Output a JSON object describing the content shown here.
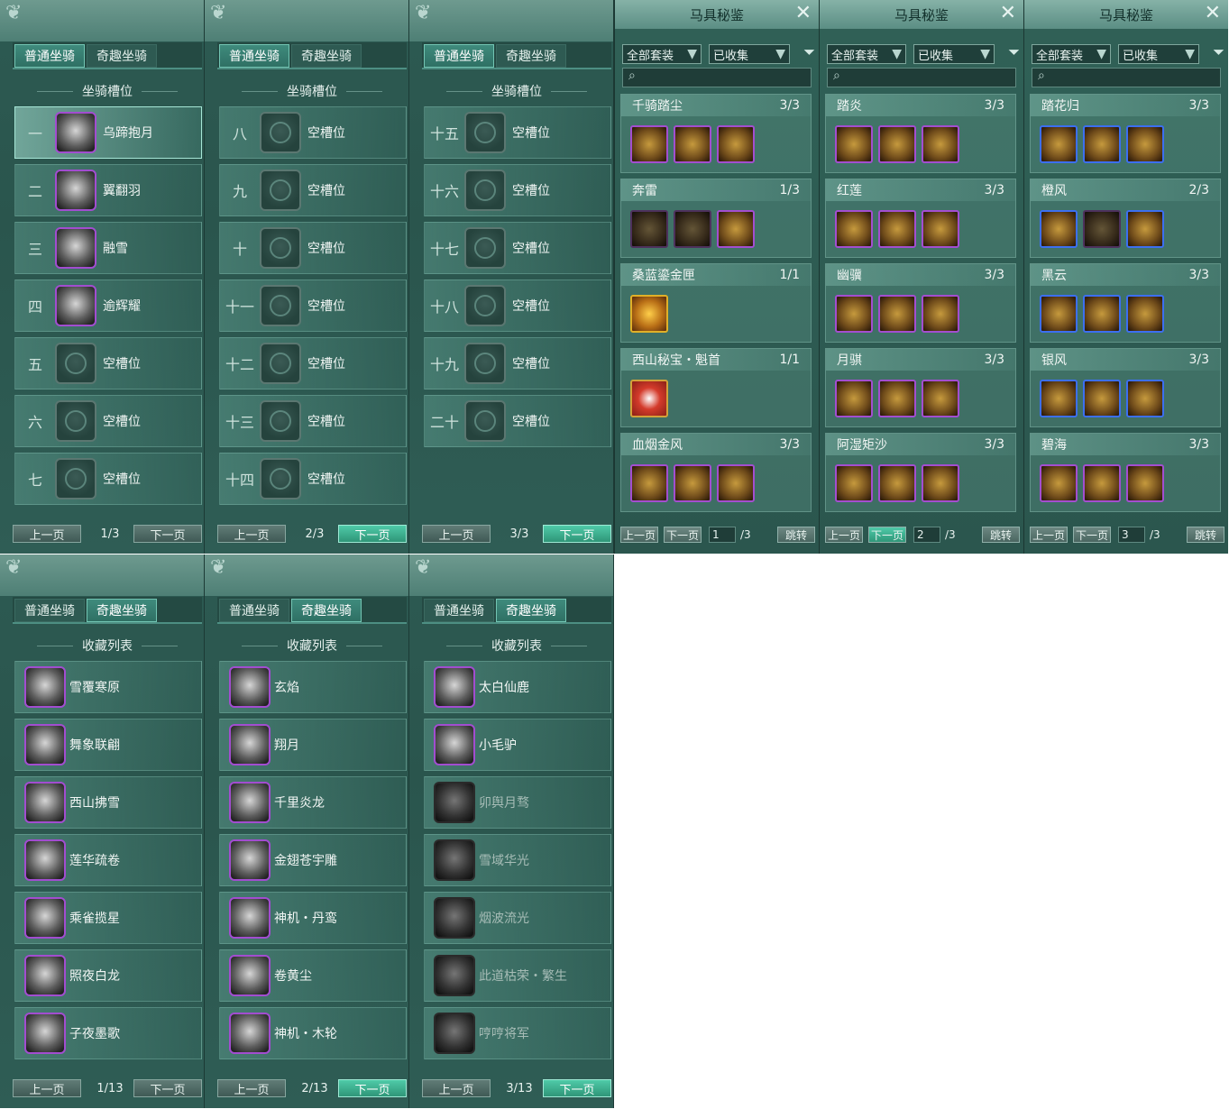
{
  "tabs": {
    "normal": "普通坐骑",
    "fun": "奇趣坐骑"
  },
  "slot_title": "坐骑槽位",
  "collect_title": "收藏列表",
  "prev": "上一页",
  "next": "下一页",
  "slot_pages": [
    {
      "page": "1/3",
      "rows": [
        {
          "num": "一",
          "name": "乌蹄抱月",
          "filled": true
        },
        {
          "num": "二",
          "name": "翼翻羽",
          "filled": true
        },
        {
          "num": "三",
          "name": "融雪",
          "filled": true
        },
        {
          "num": "四",
          "name": "逾辉耀",
          "filled": true
        },
        {
          "num": "五",
          "name": "空槽位",
          "filled": false
        },
        {
          "num": "六",
          "name": "空槽位",
          "filled": false
        },
        {
          "num": "七",
          "name": "空槽位",
          "filled": false
        }
      ]
    },
    {
      "page": "2/3",
      "rows": [
        {
          "num": "八",
          "name": "空槽位",
          "filled": false
        },
        {
          "num": "九",
          "name": "空槽位",
          "filled": false
        },
        {
          "num": "十",
          "name": "空槽位",
          "filled": false
        },
        {
          "num": "十一",
          "name": "空槽位",
          "filled": false
        },
        {
          "num": "十二",
          "name": "空槽位",
          "filled": false
        },
        {
          "num": "十三",
          "name": "空槽位",
          "filled": false
        },
        {
          "num": "十四",
          "name": "空槽位",
          "filled": false
        }
      ]
    },
    {
      "page": "3/3",
      "rows": [
        {
          "num": "十五",
          "name": "空槽位",
          "filled": false
        },
        {
          "num": "十六",
          "name": "空槽位",
          "filled": false
        },
        {
          "num": "十七",
          "name": "空槽位",
          "filled": false
        },
        {
          "num": "十八",
          "name": "空槽位",
          "filled": false
        },
        {
          "num": "十九",
          "name": "空槽位",
          "filled": false
        },
        {
          "num": "二十",
          "name": "空槽位",
          "filled": false
        }
      ]
    }
  ],
  "collect_pages": [
    {
      "page": "1/13",
      "rows": [
        {
          "name": "雪覆寒原",
          "owned": true
        },
        {
          "name": "舞象联翩",
          "owned": true
        },
        {
          "name": "西山拂雪",
          "owned": true
        },
        {
          "name": "莲华疏卷",
          "owned": true
        },
        {
          "name": "乘雀揽星",
          "owned": true
        },
        {
          "name": "照夜白龙",
          "owned": true
        },
        {
          "name": "子夜墨歌",
          "owned": true
        }
      ]
    },
    {
      "page": "2/13",
      "rows": [
        {
          "name": "玄焰",
          "owned": true
        },
        {
          "name": "翔月",
          "owned": true
        },
        {
          "name": "千里炎龙",
          "owned": true
        },
        {
          "name": "金翅苍宇雕",
          "owned": true
        },
        {
          "name": "神机・丹鸾",
          "owned": true
        },
        {
          "name": "卷黄尘",
          "owned": true
        },
        {
          "name": "神机・木轮",
          "owned": true
        }
      ]
    },
    {
      "page": "3/13",
      "rows": [
        {
          "name": "太白仙鹿",
          "owned": true
        },
        {
          "name": "小毛驴",
          "owned": true
        },
        {
          "name": "卯舆月骛",
          "owned": false
        },
        {
          "name": "雪域华光",
          "owned": false
        },
        {
          "name": "烟波流光",
          "owned": false
        },
        {
          "name": "此道枯荣・繁生",
          "owned": false
        },
        {
          "name": "哼哼将军",
          "owned": false
        }
      ]
    }
  ],
  "codex": {
    "title": "马具秘鉴",
    "filter_all": "全部套装",
    "filter_collected": "已收集",
    "jump": "跳转",
    "prev_short": "上一页",
    "next_short": "下一页",
    "total": "/3",
    "pages": [
      {
        "input": "1",
        "sets": [
          {
            "name": "千骑踏尘",
            "count": "3/3",
            "items": [
              "p",
              "p",
              "p"
            ]
          },
          {
            "name": "奔雷",
            "count": "1/3",
            "items": [
              "g",
              "g",
              "p"
            ]
          },
          {
            "name": "桑蓝鎏金匣",
            "count": "1/1",
            "items": [
              "y"
            ]
          },
          {
            "name": "西山秘宝・魁首",
            "count": "1/1",
            "items": [
              "r"
            ]
          },
          {
            "name": "血烟金风",
            "count": "3/3",
            "items": [
              "p",
              "p",
              "p"
            ]
          }
        ]
      },
      {
        "input": "2",
        "sets": [
          {
            "name": "踏炎",
            "count": "3/3",
            "items": [
              "p",
              "p",
              "p"
            ]
          },
          {
            "name": "红莲",
            "count": "3/3",
            "items": [
              "p",
              "p",
              "p"
            ]
          },
          {
            "name": "幽骥",
            "count": "3/3",
            "items": [
              "p",
              "p",
              "p"
            ]
          },
          {
            "name": "月骐",
            "count": "3/3",
            "items": [
              "p",
              "p",
              "p"
            ]
          },
          {
            "name": "阿湿矩沙",
            "count": "3/3",
            "items": [
              "p",
              "p",
              "p"
            ]
          }
        ]
      },
      {
        "input": "3",
        "sets": [
          {
            "name": "踏花归",
            "count": "3/3",
            "items": [
              "b",
              "b",
              "b"
            ]
          },
          {
            "name": "橙风",
            "count": "2/3",
            "items": [
              "b",
              "g",
              "b"
            ]
          },
          {
            "name": "黑云",
            "count": "3/3",
            "items": [
              "b",
              "b",
              "b"
            ]
          },
          {
            "name": "银风",
            "count": "3/3",
            "items": [
              "b",
              "b",
              "b"
            ]
          },
          {
            "name": "碧海",
            "count": "3/3",
            "items": [
              "p",
              "p",
              "p"
            ]
          }
        ]
      }
    ]
  }
}
